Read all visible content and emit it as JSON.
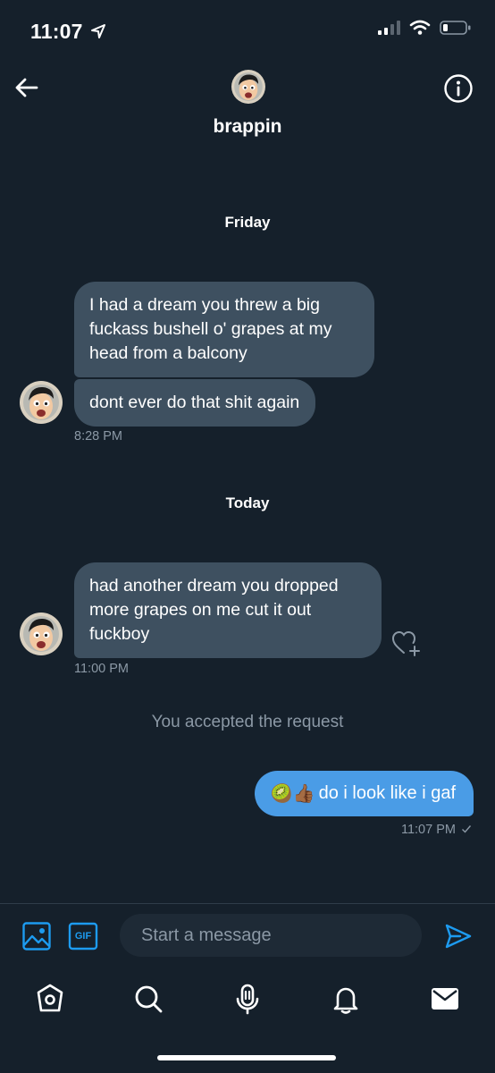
{
  "status_bar": {
    "time": "11:07"
  },
  "header": {
    "name": "brappin"
  },
  "sections": [
    {
      "label": "Friday",
      "messages": [
        "I had a dream you threw a big fuckass bushell o' grapes at my head from a balcony",
        "dont ever do that shit again"
      ],
      "time": "8:28 PM"
    },
    {
      "label": "Today",
      "messages": [
        "had another dream you dropped more grapes on me cut it out fuckboy"
      ],
      "time": "11:00 PM"
    }
  ],
  "system_note": "You accepted the request",
  "outgoing": {
    "emoji": "🥝👍🏾",
    "text": "do i look like i gaf",
    "time": "11:07 PM"
  },
  "composer": {
    "placeholder": "Start a message",
    "gif_label": "GIF"
  },
  "colors": {
    "background": "#15202b",
    "incoming_bubble": "#3e5060",
    "outgoing_bubble": "#4a9ce6",
    "accent": "#1d9bf0"
  },
  "tabs": [
    "home-icon",
    "search-icon",
    "spaces-icon",
    "notifications-icon",
    "messages-icon"
  ]
}
